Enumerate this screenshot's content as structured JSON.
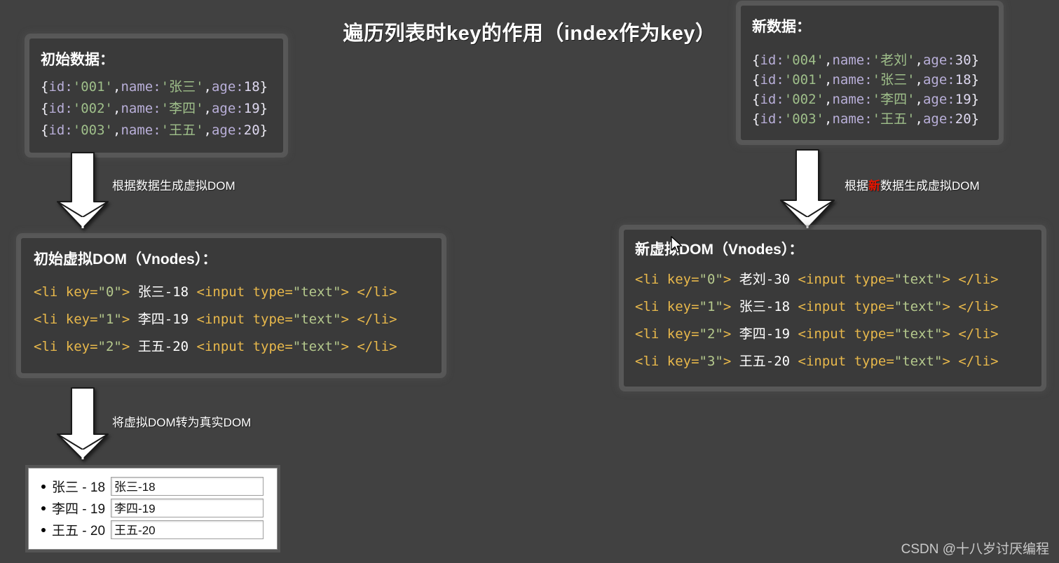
{
  "title": "遍历列表时key的作用（index作为key）",
  "watermark": "CSDN @十八岁讨厌编程",
  "colors": {
    "background": "#414141",
    "panel_background": "#3a3a3a",
    "tag": "#e8b84b",
    "string": "#9fbf8a",
    "property": "#b9afd9",
    "highlight_red": "#e51400",
    "text_white": "#ffffff"
  },
  "initial_data": {
    "title": "初始数据：",
    "rows": [
      {
        "id": "'001'",
        "name": "'张三'",
        "age": "18"
      },
      {
        "id": "'002'",
        "name": "'李四'",
        "age": "19"
      },
      {
        "id": "'003'",
        "name": "'王五'",
        "age": "20"
      }
    ]
  },
  "new_data": {
    "title": "新数据：",
    "rows": [
      {
        "id": "'004'",
        "name": "'老刘'",
        "age": "30"
      },
      {
        "id": "'001'",
        "name": "'张三'",
        "age": "18"
      },
      {
        "id": "'002'",
        "name": "'李四'",
        "age": "19"
      },
      {
        "id": "'003'",
        "name": "'王五'",
        "age": "20"
      }
    ]
  },
  "old_vnodes": {
    "title": "初始虚拟DOM（Vnodes）：",
    "rows": [
      {
        "key": "\"0\"",
        "text": "张三-18"
      },
      {
        "key": "\"1\"",
        "text": "李四-19"
      },
      {
        "key": "\"2\"",
        "text": "王五-20"
      }
    ]
  },
  "new_vnodes": {
    "title": "新虚拟DOM（Vnodes）：",
    "rows": [
      {
        "key": "\"0\"",
        "text": "老刘-30"
      },
      {
        "key": "\"1\"",
        "text": "张三-18"
      },
      {
        "key": "\"2\"",
        "text": "李四-19"
      },
      {
        "key": "\"3\"",
        "text": "王五-20"
      }
    ]
  },
  "real_dom": {
    "rows": [
      {
        "label": "张三 - 18",
        "input_value": "张三-18"
      },
      {
        "label": "李四 - 19",
        "input_value": "李四-19"
      },
      {
        "label": "王五 - 20",
        "input_value": "王五-20"
      }
    ]
  },
  "arrows": {
    "left_top": {
      "label": "根据数据生成虚拟DOM"
    },
    "right_top": {
      "label_before": "根据",
      "label_highlight": "新",
      "label_after": "数据生成虚拟DOM"
    },
    "left_bottom": {
      "label": "将虚拟DOM转为真实DOM"
    }
  },
  "code_tokens": {
    "brace_open": "{",
    "brace_close": "}",
    "id_key": "id:",
    "name_key": "name:",
    "age_key": "age:",
    "comma": ",",
    "li_open": "<li ",
    "key_attr": "key=",
    "gt": "> ",
    "input_open": " <input ",
    "type_attr": "type=",
    "type_val": "\"text\"",
    "gt2": "> ",
    "li_close": "</li>"
  }
}
